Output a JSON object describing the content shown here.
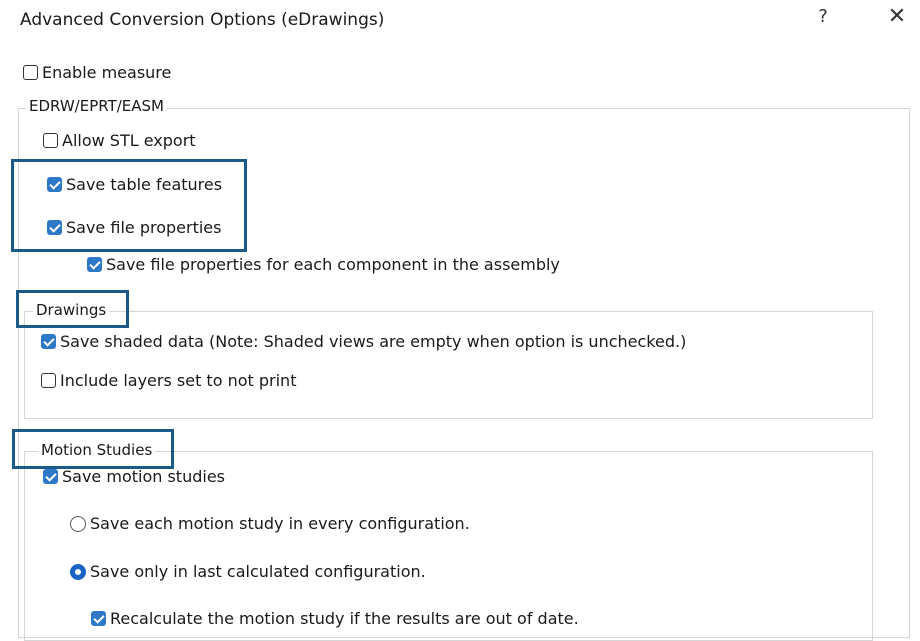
{
  "dialog": {
    "title": "Advanced Conversion Options (eDrawings)",
    "help_label": "?",
    "close_label": "✕"
  },
  "enable_measure": {
    "label": "Enable measure",
    "checked": false
  },
  "edrw_group": {
    "label": "EDRW/EPRT/EASM",
    "allow_stl": {
      "label": "Allow STL export",
      "checked": false
    },
    "save_table_features": {
      "label": "Save table features",
      "checked": true
    },
    "save_file_properties": {
      "label": "Save file properties",
      "checked": true
    },
    "save_props_each_component": {
      "label": "Save file properties for each component in the assembly",
      "checked": true
    }
  },
  "drawings_group": {
    "label": "Drawings",
    "save_shaded": {
      "label": "Save shaded data (Note: Shaded views are empty when option is unchecked.)",
      "checked": true
    },
    "include_layers": {
      "label": "Include layers set to not print",
      "checked": false
    }
  },
  "motion_group": {
    "label": "Motion Studies",
    "save_motion": {
      "label": "Save motion studies",
      "checked": true
    },
    "each_config": {
      "label": "Save each motion study in every configuration.",
      "selected": false
    },
    "last_config": {
      "label": "Save only in last calculated configuration.",
      "selected": true
    },
    "recalculate": {
      "label": "Recalculate the motion study if the results are out of date.",
      "checked": true
    }
  },
  "colors": {
    "checkbox_checked": "#2d79c7",
    "highlight_border": "#1b5a86",
    "group_border": "#d6d6d6"
  },
  "icons": {
    "help": "question-mark",
    "close": "x-mark"
  }
}
